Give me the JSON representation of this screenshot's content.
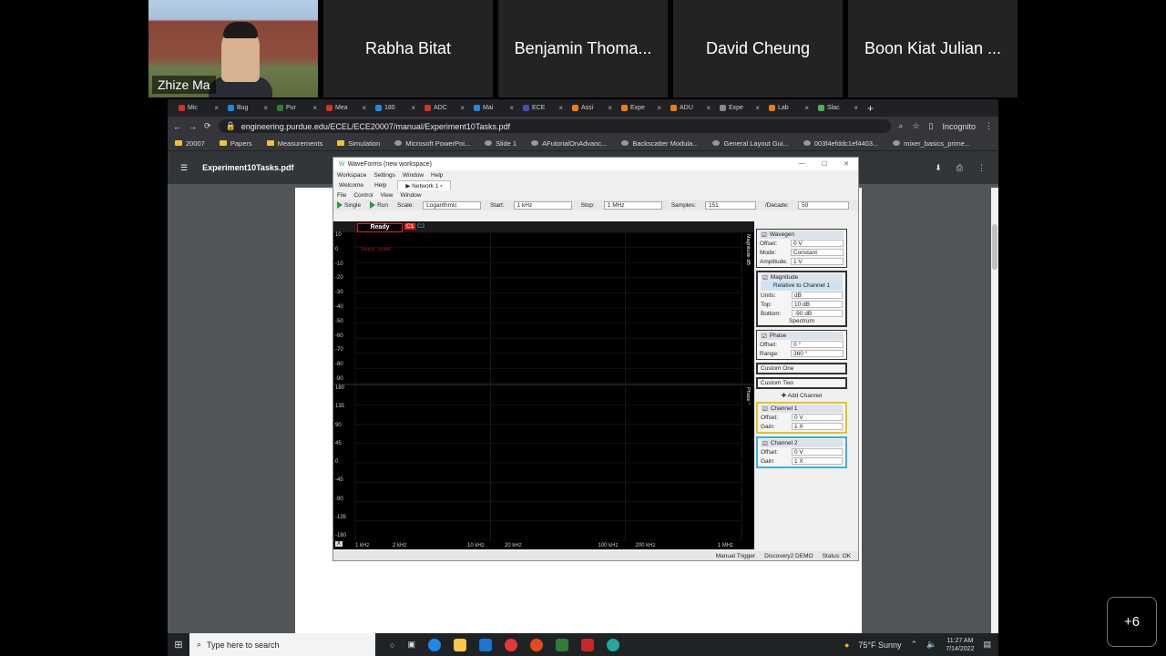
{
  "meeting": {
    "participants": [
      {
        "name": "Zhize Ma",
        "video": true
      },
      {
        "name": "Rabha Bitat"
      },
      {
        "name": "Benjamin Thoma..."
      },
      {
        "name": "David Cheung"
      },
      {
        "name": "Boon Kiat Julian ..."
      }
    ],
    "more_count": "+6"
  },
  "browser": {
    "tabs": [
      {
        "label": "Mic",
        "color": "#d93025"
      },
      {
        "label": "Bug",
        "color": "#1e88e5"
      },
      {
        "label": "Pur",
        "color": "#2e7d32"
      },
      {
        "label": "Mea",
        "color": "#d93025"
      },
      {
        "label": "180",
        "color": "#1e88e5"
      },
      {
        "label": "ADC",
        "color": "#d93025"
      },
      {
        "label": "Mai",
        "color": "#1e88e5"
      },
      {
        "label": "ECE",
        "color": "#3f51b5"
      },
      {
        "label": "Assi",
        "color": "#f57c00"
      },
      {
        "label": "Expe",
        "color": "#f57c00"
      },
      {
        "label": "ADU",
        "color": "#f57c00"
      },
      {
        "label": "Expe",
        "color": "#888888"
      },
      {
        "label": "Lab",
        "color": "#f57c00"
      },
      {
        "label": "Slac",
        "color": "#4caf50"
      }
    ],
    "url": "engineering.purdue.edu/ECEL/ECE20007/manual/Experiment10Tasks.pdf",
    "profile": "Incognito",
    "bookmarks": [
      "20007",
      "Papers",
      "Measurements",
      "Simulation",
      "Microsoft PowerPoi...",
      "Slide 1",
      "AFutorialOnAdvanc...",
      "Backscatter Modula...",
      "General Layout Gui...",
      "003f4efddc1ef4403...",
      "mixer_basics_prime..."
    ],
    "pdf_title": "Experiment10Tasks.pdf"
  },
  "waveforms": {
    "title": "WaveForms (new workspace)",
    "menu1": [
      "Workspace",
      "Settings",
      "Window",
      "Help"
    ],
    "tabs": [
      "Welcome",
      "Help",
      "Network 1"
    ],
    "menu2": [
      "File",
      "Control",
      "View",
      "Window"
    ],
    "toolbar": {
      "single": "Single",
      "run": "Run",
      "scale_label": "Scale:",
      "scale": "Logarithmic",
      "start_label": "Start:",
      "start": "1 kHz",
      "stop_label": "Stop:",
      "stop": "1 MHz",
      "samples_label": "Samples:",
      "samples": "151",
      "decade_label": "/Decade:",
      "decade": "50"
    },
    "status": "Ready",
    "demo": "Demo mode",
    "c1": "C1",
    "c2": "C2",
    "mag_axis": [
      "10",
      "0",
      "-10",
      "-20",
      "-30",
      "-40",
      "-50",
      "-60",
      "-70",
      "-80",
      "-90"
    ],
    "phase_axis": [
      "180",
      "135",
      "90",
      "45",
      "0",
      "-45",
      "-90",
      "-135",
      "-180"
    ],
    "x_axis": [
      "1 kHz",
      "2 kHz",
      "10 kHz",
      "20 kHz",
      "100 kHz",
      "200 kHz",
      "1 MHz"
    ],
    "x_button": "X",
    "right_labels": {
      "magnitude": "Magnitude dB",
      "phase": "Phase °"
    },
    "wavegen": {
      "title": "Wavegen",
      "offset": "0 V",
      "mode": "Constant",
      "amplitude": "1 V"
    },
    "magnitude": {
      "title": "Magnitude",
      "relative": "Relative to Channel 1",
      "units": "dB",
      "top": "10 dB",
      "bottom": "-90 dB",
      "spectrum": "Spectrum"
    },
    "phase": {
      "title": "Phase",
      "offset": "0 °",
      "range": "360 °"
    },
    "custom": [
      "Custom One",
      "Custom Two"
    ],
    "add_channel": "Add Channel",
    "channel1": {
      "title": "Channel 1",
      "offset": "0 V",
      "gain": "1 X"
    },
    "channel2": {
      "title": "Channel 2",
      "offset": "0 V",
      "gain": "1 X"
    },
    "labels": {
      "offset": "Offset:",
      "mode": "Mode:",
      "amplitude": "Amplitude:",
      "units": "Units:",
      "top": "Top:",
      "bottom": "Bottom:",
      "range": "Range:",
      "gain": "Gain:"
    },
    "footer": [
      "Manual Trigger",
      "Discovery2 DEMO",
      "Status: OK"
    ]
  },
  "taskbar": {
    "search_placeholder": "Type here to search",
    "weather": "75°F Sunny",
    "time": "11:27 AM",
    "date": "7/14/2022"
  }
}
